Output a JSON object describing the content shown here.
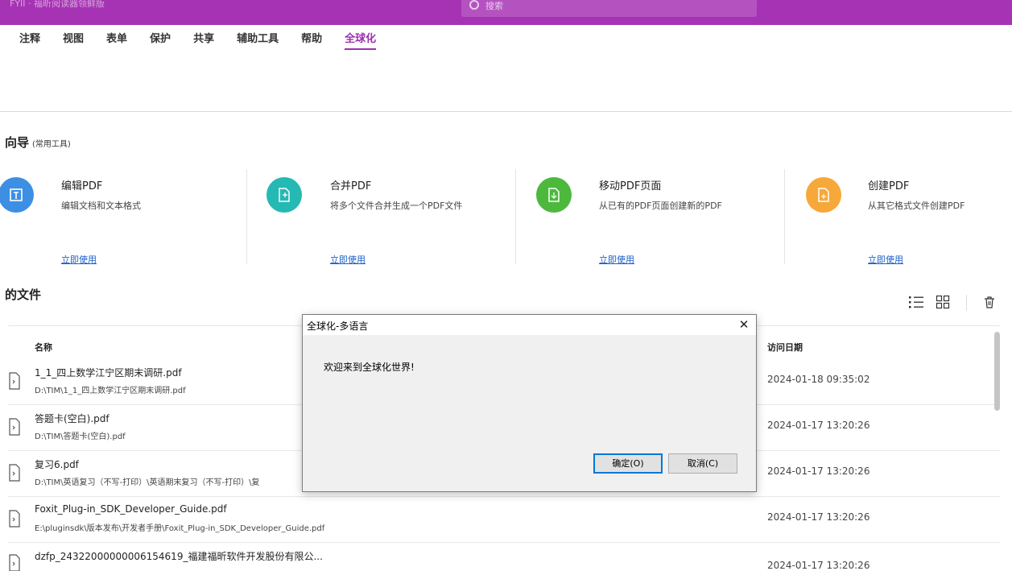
{
  "titlebar": {
    "fragment": "FYII · 福昕阅读器领鲜版",
    "search_placeholder": "搜索"
  },
  "ribbon": {
    "tabs": [
      {
        "label": "注释"
      },
      {
        "label": "视图"
      },
      {
        "label": "表单"
      },
      {
        "label": "保护"
      },
      {
        "label": "共享"
      },
      {
        "label": "辅助工具"
      },
      {
        "label": "帮助"
      },
      {
        "label": "全球化"
      }
    ],
    "active_tab": "全球化"
  },
  "guide": {
    "title": "向导",
    "subtitle": "(常用工具)",
    "cards": [
      {
        "title": "编辑PDF",
        "desc": "编辑文档和文本格式",
        "link": "立即使用",
        "icon": "edit-text-icon",
        "color": "#3d8fe3"
      },
      {
        "title": "合并PDF",
        "desc": "将多个文件合并生成一个PDF文件",
        "link": "立即使用",
        "icon": "merge-icon",
        "color": "#25b9b3"
      },
      {
        "title": "移动PDF页面",
        "desc": "从已有的PDF页面创建新的PDF",
        "link": "立即使用",
        "icon": "move-pages-icon",
        "color": "#4cb93d"
      },
      {
        "title": "创建PDF",
        "desc": "从其它格式文件创建PDF",
        "link": "立即使用",
        "icon": "create-pdf-icon",
        "color": "#f7a83a"
      }
    ]
  },
  "files": {
    "title": "的文件",
    "col_name": "名称",
    "col_date": "访问日期",
    "rows": [
      {
        "name": "1_1_四上数学江宁区期末调研.pdf",
        "path": "D:\\TIM\\1_1_四上数学江宁区期末调研.pdf",
        "date": "2024-01-18 09:35:02"
      },
      {
        "name": "答题卡(空白).pdf",
        "path": "D:\\TIM\\答题卡(空白).pdf",
        "date": "2024-01-17 13:20:26"
      },
      {
        "name": "复习6.pdf",
        "path": "D:\\TIM\\英语复习（不写-打印）\\英语期末复习（不写-打印）\\复",
        "date": "2024-01-17 13:20:26"
      },
      {
        "name": "Foxit_Plug-in_SDK_Developer_Guide.pdf",
        "path": "E:\\pluginsdk\\版本发布\\开发者手册\\Foxit_Plug-in_SDK_Developer_Guide.pdf",
        "date": "2024-01-17 13:20:26"
      },
      {
        "name": "dzfp_24322000000006154619_福建福昕软件开发股份有限公...",
        "path": "",
        "date": "2024-01-17 13:20:26"
      }
    ]
  },
  "dialog": {
    "title": "全球化-多语言",
    "message": "欢迎来到全球化世界!",
    "ok_label": "确定(O)",
    "cancel_label": "取消(C)",
    "close_glyph": "✕"
  }
}
